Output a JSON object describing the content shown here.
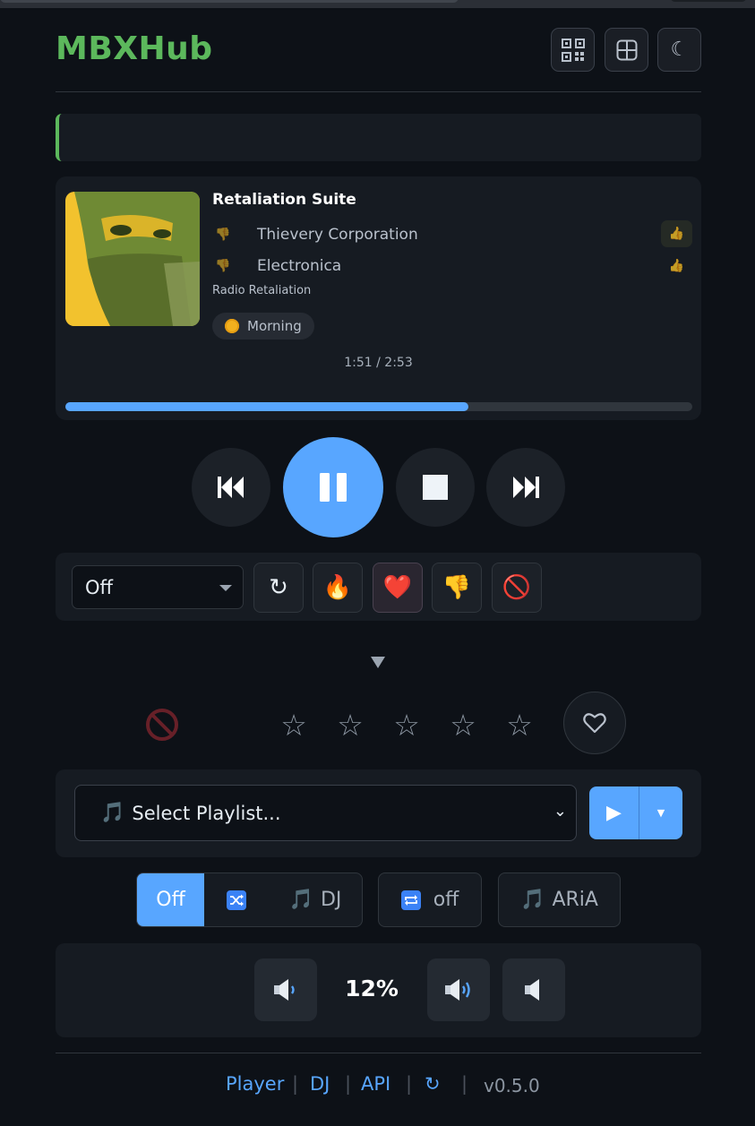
{
  "header": {
    "brand": "MBXHub",
    "buttons": [
      {
        "name": "qr-code-icon"
      },
      {
        "name": "grid-layout-icon"
      },
      {
        "name": "moon-icon",
        "glyph": "☾"
      }
    ]
  },
  "now_playing": {
    "title": "Retaliation Suite",
    "artist": "Thievery Corporation",
    "genre": "Electronica",
    "station": "Radio Retaliation",
    "mood": "Morning",
    "time": "1:51 / 2:53",
    "progress_fraction": 0.643
  },
  "controls": {
    "mode_select": "Off",
    "reload_glyph": "↻",
    "fire_glyph": "🔥",
    "heart_glyph": "❤️",
    "dislike_glyph": "👎",
    "ban_glyph": "🚫"
  },
  "rating": {
    "stars": 0,
    "max_stars": 5,
    "star_glyph": "☆"
  },
  "playlist": {
    "note_glyph": "🎵",
    "placeholder": "Select Playlist...",
    "chevron_glyph": "⌄",
    "play_glyph": "▶",
    "dropdown_glyph": "▼"
  },
  "modes": {
    "shuffle_off_label": "Off",
    "dj_label": "DJ",
    "repeat_label": "off",
    "aria_label": "ARiA",
    "note_glyph": "🎵"
  },
  "volume": {
    "percent_label": "12%"
  },
  "footer": {
    "links": [
      "Player",
      "DJ",
      "API"
    ],
    "refresh_glyph": "↻",
    "separator": "|",
    "version": "v0.5.0"
  },
  "colors": {
    "brand": "#5cb85c",
    "accent": "#58a6ff",
    "background": "#0d1117",
    "panel": "#161b22"
  }
}
